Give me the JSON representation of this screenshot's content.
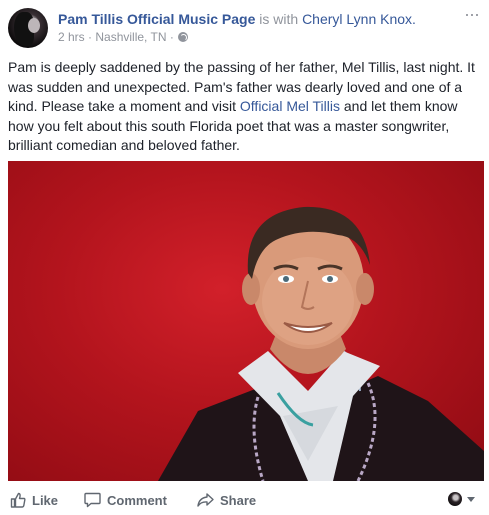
{
  "post": {
    "author": "Pam Tillis Official Music Page",
    "with_text": "is with",
    "tagged": "Cheryl Lynn Knox.",
    "time": "2 hrs",
    "location": "Nashville, TN",
    "separator": "·",
    "more_label": "···",
    "text_before_link": "Pam is deeply saddened by the passing of her father, Mel Tillis, last night. It was sudden and unexpected. Pam's father was dearly loved and one of a kind. Please take a moment and visit ",
    "link_text": "Official Mel Tillis",
    "text_after_link": " and let them know how you felt about this south Florida poet that was a master songwriter, brilliant comedian and beloved father.",
    "photo_icon": "portrait-photo"
  },
  "actions": {
    "like": "Like",
    "comment": "Comment",
    "share": "Share"
  },
  "icons": {
    "like": "thumbs-up-icon",
    "comment": "speech-bubble-icon",
    "share": "share-arrow-icon",
    "privacy": "globe-icon",
    "more": "ellipsis-icon"
  },
  "colors": {
    "link": "#365899",
    "meta": "#90949c",
    "text": "#1d2129",
    "photo_background": "#c0141e"
  }
}
